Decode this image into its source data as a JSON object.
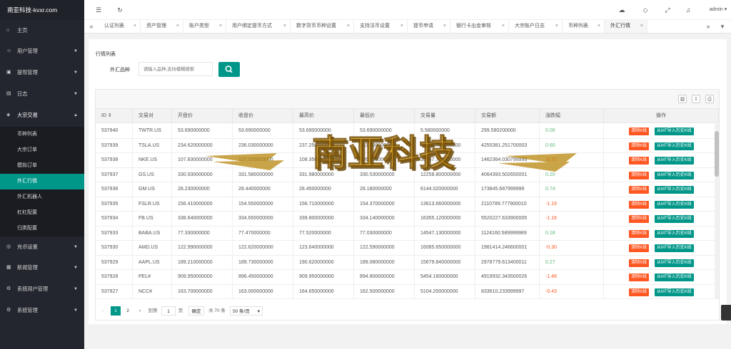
{
  "brand": {
    "title": "南亚科技-kvxr.com"
  },
  "sidebar": {
    "items": [
      {
        "label": "主页",
        "icon": "home-icon"
      },
      {
        "label": "用户管理",
        "icon": "user-icon"
      },
      {
        "label": "提现管理",
        "icon": "wallet-icon"
      },
      {
        "label": "日志",
        "icon": "log-icon"
      },
      {
        "label": "大宗交易",
        "icon": "trade-icon"
      },
      {
        "label": "充币设置",
        "icon": "coin-icon"
      },
      {
        "label": "新闻管理",
        "icon": "news-icon"
      },
      {
        "label": "系统用户管理",
        "icon": "admin-icon"
      },
      {
        "label": "系统管理",
        "icon": "settings-icon"
      }
    ],
    "subitems": [
      "币种列表",
      "大宗订单",
      "模拟订单",
      "外汇行情",
      "外汇机器人",
      "杠杠配置",
      "归类配置"
    ]
  },
  "topbar": {
    "user": "admin"
  },
  "tabs": [
    "认证列表",
    "资产管理",
    "账户类型",
    "用户绑定提币方式",
    "数字货币币种设置",
    "支持法币设置",
    "提币申请",
    "银行卡出金审核",
    "大宗账户日志",
    "币种列表",
    "外汇行情"
  ],
  "card": {
    "title": "行情列表",
    "filter_label": "外汇品种",
    "filter_placeholder": "请输入品种,支持模糊搜索"
  },
  "table": {
    "columns": [
      "ID",
      "交易对",
      "开盘价",
      "收盘价",
      "最高价",
      "最低价",
      "交易量",
      "交易额",
      "涨跌幅",
      "操作"
    ],
    "rows": [
      {
        "id": "537940",
        "pair": "TWTR.US",
        "open": "53.690000000",
        "close": "53.690000000",
        "high": "53.690000000",
        "low": "53.690000000",
        "vol": "5.580000000",
        "amt": "299.590200000",
        "chg": "0.00",
        "dir": "pos"
      },
      {
        "id": "537939",
        "pair": "TSLA.US",
        "open": "234.620000000",
        "close": "236.030000000",
        "high": "237.250000000",
        "low": "233.600000000",
        "vol": "17988.726000000",
        "amt": "4255381.251700003",
        "chg": "0.60",
        "dir": "pos"
      },
      {
        "id": "537938",
        "pair": "NKE.US",
        "open": "107.830000000",
        "close": "107.050000000",
        "high": "108.350000000",
        "low": "106.560000000",
        "vol": "13647.760000000",
        "amt": "1462364.030799999",
        "chg": "-0.72",
        "dir": "neg"
      },
      {
        "id": "537937",
        "pair": "GS.US",
        "open": "330.930000000",
        "close": "331.580000000",
        "high": "331.980000000",
        "low": "330.530000000",
        "vol": "12258.800000000",
        "amt": "4064393.502650001",
        "chg": "0.20",
        "dir": "pos"
      },
      {
        "id": "537936",
        "pair": "GM.US",
        "open": "28.230000000",
        "close": "28.440000000",
        "high": "28.450000000",
        "low": "28.180000000",
        "vol": "6144.020000000",
        "amt": "173845.687999999",
        "chg": "0.74",
        "dir": "pos"
      },
      {
        "id": "537935",
        "pair": "FSLR.US",
        "open": "156.410000000",
        "close": "154.550000000",
        "high": "156.710000000",
        "low": "154.370000000",
        "vol": "13613.660000000",
        "amt": "2110789.777900010",
        "chg": "-1.19",
        "dir": "neg"
      },
      {
        "id": "537934",
        "pair": "FB.US",
        "open": "338.640000000",
        "close": "334.650000000",
        "high": "339.800000000",
        "low": "334.140000000",
        "vol": "16355.120000000",
        "amt": "5520227.633900005",
        "chg": "-1.18",
        "dir": "neg"
      },
      {
        "id": "537933",
        "pair": "BABA.US",
        "open": "77.330000000",
        "close": "77.470000000",
        "high": "77.520000000",
        "low": "77.030000000",
        "vol": "14547.130000000",
        "amt": "1124160.589999989",
        "chg": "0.18",
        "dir": "pos"
      },
      {
        "id": "537930",
        "pair": "AMD.US",
        "open": "122.990000000",
        "close": "122.620000000",
        "high": "123.640000000",
        "low": "122.590000000",
        "vol": "16085.650000000",
        "amt": "1981414.246600001",
        "chg": "-0.30",
        "dir": "neg"
      },
      {
        "id": "537929",
        "pair": "AAPL.US",
        "open": "189.210000000",
        "close": "189.730000000",
        "high": "190.620000000",
        "low": "189.080000000",
        "vol": "15679.840000000",
        "amt": "2978779.613400011",
        "chg": "0.27",
        "dir": "pos"
      },
      {
        "id": "537928",
        "pair": "PEL#",
        "open": "909.950000000",
        "close": "896.450000000",
        "high": "909.950000000",
        "low": "894.800000000",
        "vol": "5454.160000000",
        "amt": "4919932.343500026",
        "chg": "-1.48",
        "dir": "neg"
      },
      {
        "id": "537927",
        "pair": "NCC#",
        "open": "163.700000000",
        "close": "163.000000000",
        "high": "164.650000000",
        "low": "162.500000000",
        "vol": "5104.200000000",
        "amt": "833610.233999997",
        "chg": "-0.43",
        "dir": "neg"
      }
    ],
    "actions": {
      "clear": "清除K线",
      "import": "从MT导入历史K线"
    }
  },
  "pager": {
    "prev": "‹",
    "p1": "1",
    "p2": "2",
    "next": "›",
    "goto": "到第",
    "page_input": "1",
    "page_unit": "页",
    "confirm": "确定",
    "total": "共 70 条",
    "per_page": "50 条/页"
  },
  "watermark": {
    "text": "南亚科技"
  },
  "colors": {
    "accent": "#009688",
    "danger": "#ff5722",
    "sidebar": "#23262e"
  }
}
